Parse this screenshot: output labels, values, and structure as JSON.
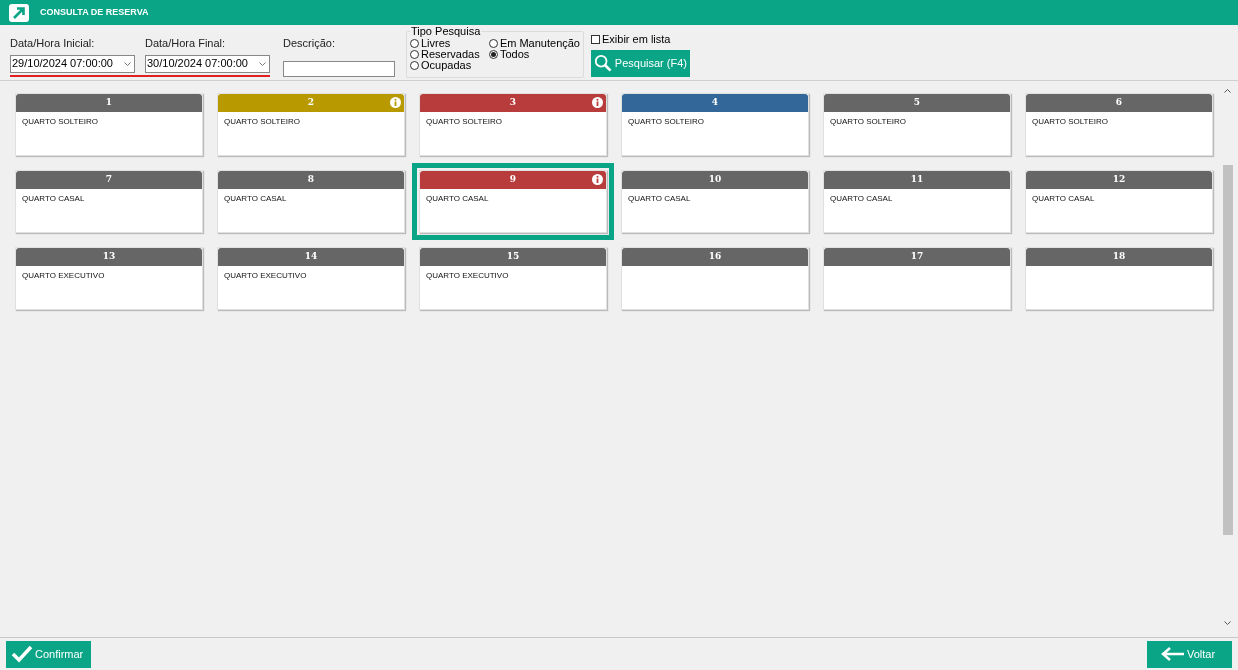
{
  "window": {
    "title": "CONSULTA DE RESERVA"
  },
  "filters": {
    "start": {
      "label": "Data/Hora Inicial:",
      "value": "29/10/2024 07:00:00"
    },
    "end": {
      "label": "Data/Hora Final:",
      "value": "30/10/2024 07:00:00"
    },
    "description": {
      "label": "Descrição:"
    },
    "search_type": {
      "label": "Tipo Pesquisa",
      "options": [
        {
          "label": "Livres",
          "selected": false
        },
        {
          "label": "Em Manutenção",
          "selected": false
        },
        {
          "label": "Reservadas",
          "selected": false
        },
        {
          "label": "Todos",
          "selected": true
        },
        {
          "label": "Ocupadas",
          "selected": false
        }
      ]
    },
    "show_list": {
      "label": "Exibir em lista",
      "checked": false
    },
    "search_button": "Pesquisar (F4)"
  },
  "rooms": [
    {
      "number": "1",
      "type": "QUARTO SOLTEIRO",
      "color": "#666666",
      "info": false,
      "selected": false
    },
    {
      "number": "2",
      "type": "QUARTO SOLTEIRO",
      "color": "#b89a00",
      "info": true,
      "selected": false
    },
    {
      "number": "3",
      "type": "QUARTO SOLTEIRO",
      "color": "#b83c3c",
      "info": true,
      "selected": false
    },
    {
      "number": "4",
      "type": "QUARTO SOLTEIRO",
      "color": "#336699",
      "info": false,
      "selected": false
    },
    {
      "number": "5",
      "type": "QUARTO SOLTEIRO",
      "color": "#666666",
      "info": false,
      "selected": false
    },
    {
      "number": "6",
      "type": "QUARTO SOLTEIRO",
      "color": "#666666",
      "info": false,
      "selected": false
    },
    {
      "number": "7",
      "type": "QUARTO CASAL",
      "color": "#666666",
      "info": false,
      "selected": false
    },
    {
      "number": "8",
      "type": "QUARTO CASAL",
      "color": "#666666",
      "info": false,
      "selected": false
    },
    {
      "number": "9",
      "type": "QUARTO CASAL",
      "color": "#b83c3c",
      "info": true,
      "selected": true
    },
    {
      "number": "10",
      "type": "QUARTO CASAL",
      "color": "#666666",
      "info": false,
      "selected": false
    },
    {
      "number": "11",
      "type": "QUARTO CASAL",
      "color": "#666666",
      "info": false,
      "selected": false
    },
    {
      "number": "12",
      "type": "QUARTO CASAL",
      "color": "#666666",
      "info": false,
      "selected": false
    },
    {
      "number": "13",
      "type": "QUARTO EXECUTIVO",
      "color": "#666666",
      "info": false,
      "selected": false
    },
    {
      "number": "14",
      "type": "QUARTO EXECUTIVO",
      "color": "#666666",
      "info": false,
      "selected": false
    },
    {
      "number": "15",
      "type": "QUARTO EXECUTIVO",
      "color": "#666666",
      "info": false,
      "selected": false
    },
    {
      "number": "16",
      "color": "#666666",
      "info": false,
      "selected": false
    },
    {
      "number": "17",
      "color": "#666666",
      "info": false,
      "selected": false
    },
    {
      "number": "18",
      "color": "#666666",
      "info": false,
      "selected": false
    }
  ],
  "footer": {
    "confirm": "Confirmar",
    "back": "Voltar"
  }
}
